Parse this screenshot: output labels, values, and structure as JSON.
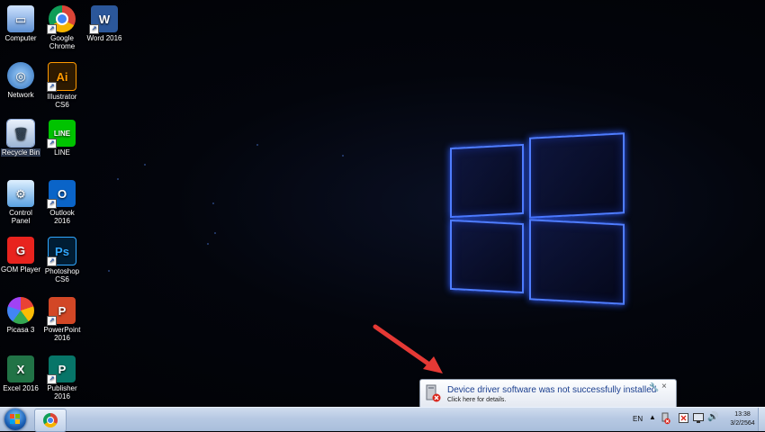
{
  "desktop": {
    "icons": [
      {
        "label": "Computer",
        "icon": "computer-icon"
      },
      {
        "label": "Google Chrome",
        "icon": "chrome-icon"
      },
      {
        "label": "Word 2016",
        "icon": "word-icon"
      },
      {
        "label": "Network",
        "icon": "network-icon"
      },
      {
        "label": "Illustrator CS6",
        "icon": "illustrator-icon"
      },
      {
        "label": "Recycle Bin",
        "icon": "recycle-bin-icon",
        "selected": true
      },
      {
        "label": "LINE",
        "icon": "line-icon"
      },
      {
        "label": "Control Panel",
        "icon": "control-panel-icon"
      },
      {
        "label": "Outlook 2016",
        "icon": "outlook-icon"
      },
      {
        "label": "GOM Player",
        "icon": "gom-player-icon"
      },
      {
        "label": "Photoshop CS6",
        "icon": "photoshop-icon"
      },
      {
        "label": "Picasa 3",
        "icon": "picasa-icon"
      },
      {
        "label": "PowerPoint 2016",
        "icon": "powerpoint-icon"
      },
      {
        "label": "Excel 2016",
        "icon": "excel-icon"
      },
      {
        "label": "Publisher 2016",
        "icon": "publisher-icon"
      }
    ]
  },
  "notification": {
    "title": "Device driver software was not successfully installed",
    "subtitle": "Click here for details.",
    "icon": "device-driver-error-icon"
  },
  "taskbar": {
    "start_icon": "windows-start-icon",
    "pinned": [
      {
        "name": "Google Chrome",
        "icon": "chrome-icon"
      }
    ],
    "tray": {
      "language": "EN",
      "time": "13:38",
      "date": "3/2/2564"
    }
  },
  "colors": {
    "taskbar": "#b7c9e3",
    "notification_title": "#1b3f8f",
    "logo_glow": "#4f7dff",
    "arrow": "#e53935"
  }
}
